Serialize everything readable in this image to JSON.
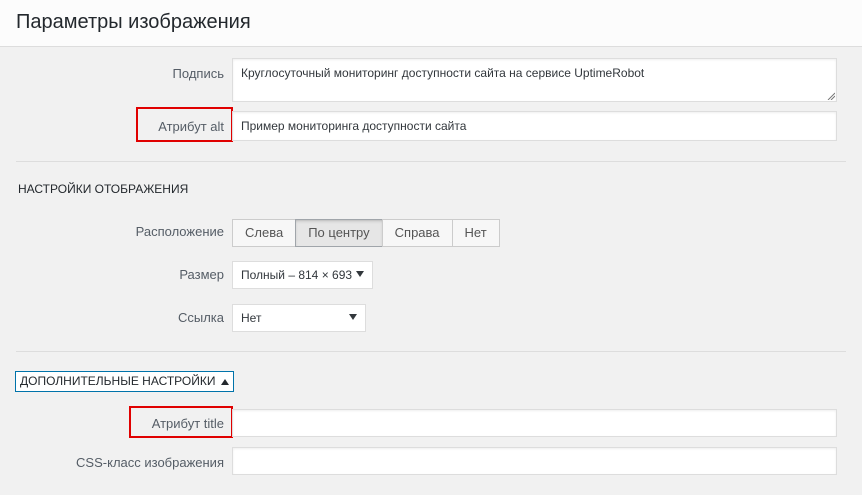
{
  "header": {
    "title": "Параметры изображения"
  },
  "caption": {
    "label": "Подпись",
    "value": "Круглосуточный мониторинг доступности сайта на сервисе UptimeRobot"
  },
  "alt": {
    "label": "Атрибут alt",
    "value": "Пример мониторинга доступности сайта"
  },
  "display_settings": {
    "title": "НАСТРОЙКИ ОТОБРАЖЕНИЯ",
    "align": {
      "label": "Расположение",
      "options": [
        "Слева",
        "По центру",
        "Справа",
        "Нет"
      ],
      "selected": "По центру"
    },
    "size": {
      "label": "Размер",
      "value": "Полный – 814 × 693"
    },
    "link": {
      "label": "Ссылка",
      "value": "Нет"
    }
  },
  "advanced": {
    "toggle_label": "ДОПОЛНИТЕЛЬНЫЕ НАСТРОЙКИ",
    "title_attr": {
      "label": "Атрибут title",
      "value": ""
    },
    "css_class": {
      "label": "CSS-класс изображения",
      "value": ""
    }
  },
  "colors": {
    "highlight": "#e00000",
    "accent": "#0073aa",
    "background": "#f1f1f1"
  }
}
